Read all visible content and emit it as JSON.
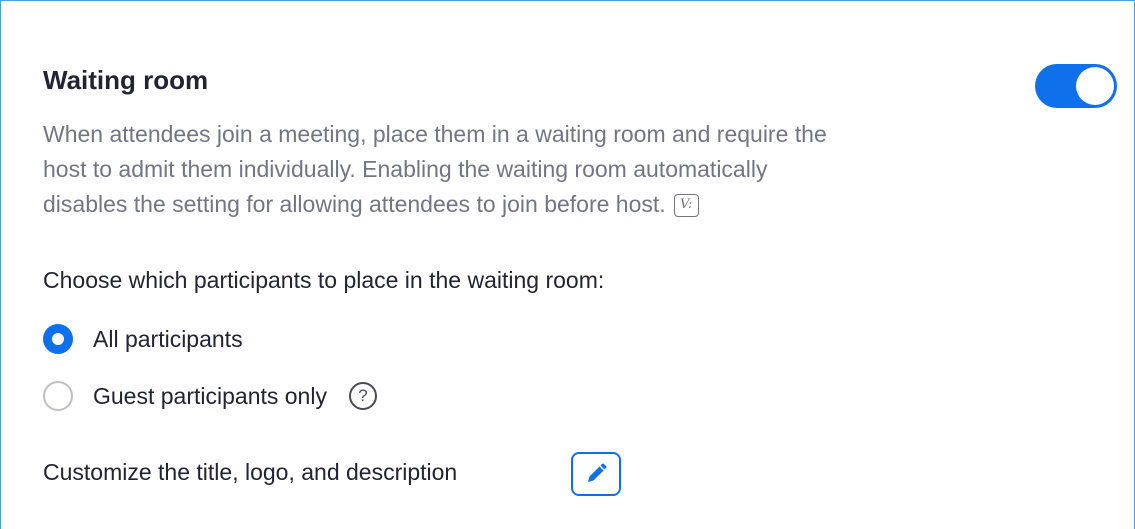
{
  "setting": {
    "title": "Waiting room",
    "enabled": true,
    "description_lines": [
      "When attendees join a meeting, place them in a waiting room and require the",
      "host to admit them individually. Enabling the waiting room automatically",
      "disables the setting for allowing attendees to join before host."
    ],
    "vip_badge": "V:"
  },
  "participants": {
    "label": "Choose which participants to place in the waiting room:",
    "options": [
      {
        "label": "All participants",
        "selected": true
      },
      {
        "label": "Guest participants only",
        "selected": false
      }
    ],
    "help_icon": "?"
  },
  "customize": {
    "label": "Customize the title, logo, and description",
    "icon": "pencil-icon"
  },
  "colors": {
    "accent": "#0e71eb",
    "border": "#4aa3df",
    "text": "#232333",
    "muted_text": "#747487"
  }
}
